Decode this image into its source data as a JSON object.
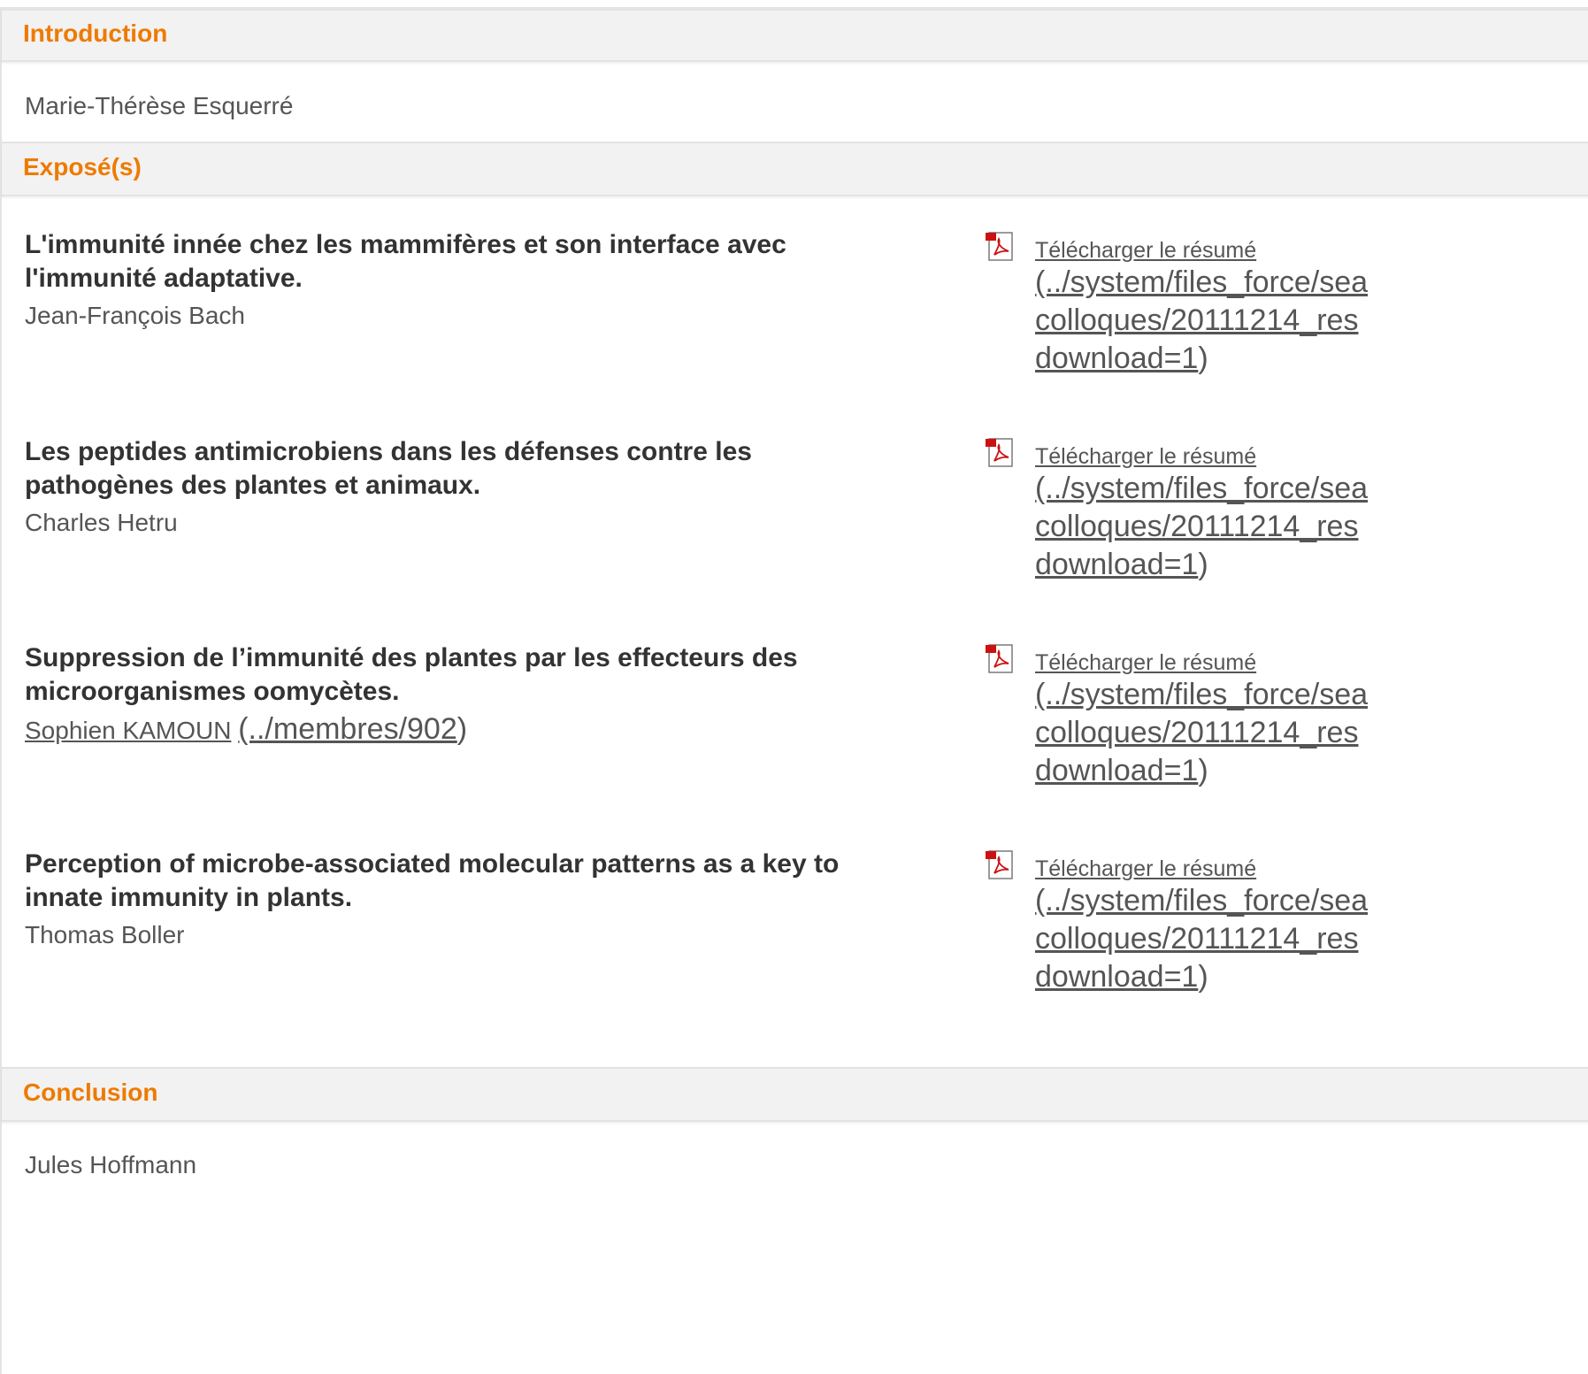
{
  "introduction": {
    "title": "Introduction",
    "name": "Marie-Thérèse Esquerré"
  },
  "exposes": {
    "title": "Exposé(s)",
    "items": [
      {
        "title_line1": "L'immunité innée chez les mammifères et son interface avec",
        "title_line2": "l'immunité adaptative.",
        "author": "Jean-François Bach",
        "download_label": "Télécharger le résumé",
        "path_line1": "(../system/files_force/sea",
        "path_line2": "colloques/20111214_res",
        "path_line3": "download=1"
      },
      {
        "title_line1": "Les peptides antimicrobiens dans les défenses contre les",
        "title_line2": "pathogènes des plantes et animaux.",
        "author": "Charles Hetru",
        "download_label": "Télécharger le résumé",
        "path_line1": "(../system/files_force/sea",
        "path_line2": "colloques/20111214_res",
        "path_line3": "download=1"
      },
      {
        "title_line1": "Suppression de l’immunité des plantes par les effecteurs des",
        "title_line2": "microorganismes oomycètes.",
        "author": "Sophien KAMOUN",
        "author_url": "(../membres/902",
        "download_label": "Télécharger le résumé",
        "path_line1": "(../system/files_force/sea",
        "path_line2": "colloques/20111214_res",
        "path_line3": "download=1"
      },
      {
        "title_line1": "Perception of microbe-associated molecular patterns as a key to",
        "title_line2": "innate immunity in plants.",
        "author": "Thomas Boller",
        "download_label": "Télécharger le résumé",
        "path_line1": "(../system/files_force/sea",
        "path_line2": "colloques/20111214_res",
        "path_line3": "download=1"
      }
    ],
    "icon": "pdf-icon",
    "closing_paren": ")"
  },
  "conclusion": {
    "title": "Conclusion",
    "name": "Jules Hoffmann"
  },
  "colors": {
    "accent": "#ee7a00",
    "text": "#555555",
    "header_bg": "#f2f2f2"
  }
}
